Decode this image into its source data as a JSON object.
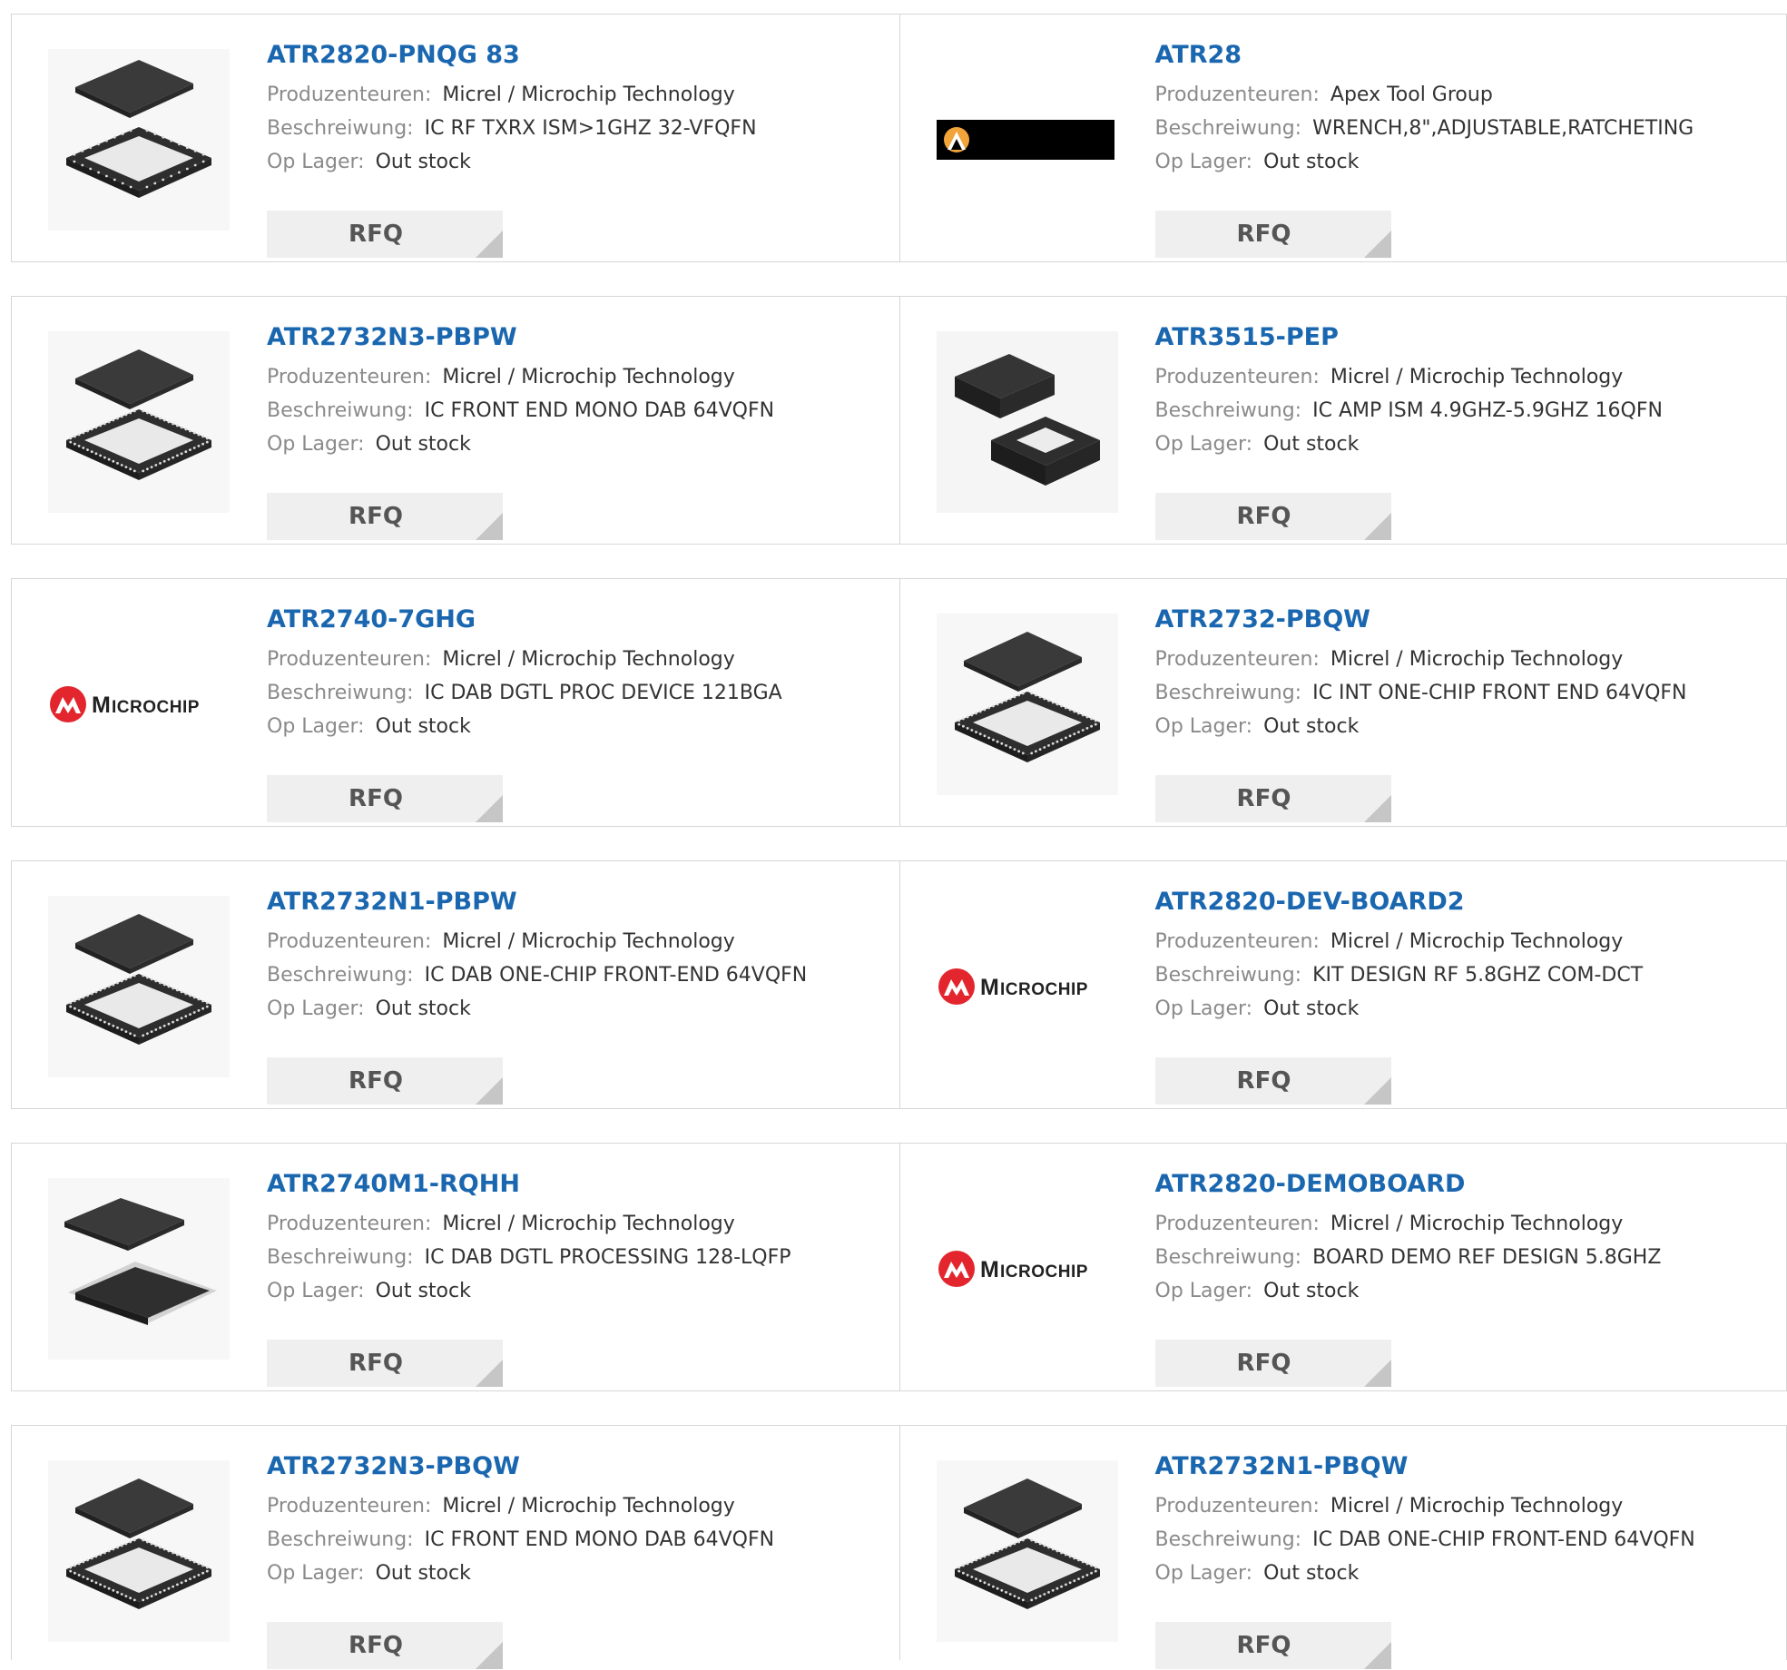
{
  "labels": {
    "manufacturer": "Produzenteuren:",
    "description": "Beschreiwung:",
    "stock": "Op Lager:",
    "rfq": "RFQ"
  },
  "colors": {
    "part_link": "#1a67b0",
    "rfq_bg": "#efefef",
    "microchip_red": "#e3262d"
  },
  "products": [
    {
      "part": "ATR2820-PNQG 83",
      "manufacturer": "Micrel / Microchip Technology",
      "description": "IC RF TXRX ISM>1GHZ 32-VFQFN",
      "stock": "Out stock",
      "image": "qfn-32-chip-icon"
    },
    {
      "part": "ATR28",
      "manufacturer": "Apex Tool Group",
      "description": "WRENCH,8\",ADJUSTABLE,RATCHETING",
      "stock": "Out stock",
      "image": "apex-logo-icon"
    },
    {
      "part": "ATR2732N3-PBPW",
      "manufacturer": "Micrel / Microchip Technology",
      "description": "IC FRONT END MONO DAB 64VQFN",
      "stock": "Out stock",
      "image": "qfn-64-chip-icon"
    },
    {
      "part": "ATR3515-PEP",
      "manufacturer": "Micrel / Microchip Technology",
      "description": "IC AMP ISM 4.9GHZ-5.9GHZ 16QFN",
      "stock": "Out stock",
      "image": "qfn-16-chip-icon"
    },
    {
      "part": "ATR2740-7GHG",
      "manufacturer": "Micrel / Microchip Technology",
      "description": "IC DAB DGTL PROC DEVICE 121BGA",
      "stock": "Out stock",
      "image": "microchip-logo-icon"
    },
    {
      "part": "ATR2732-PBQW",
      "manufacturer": "Micrel / Microchip Technology",
      "description": "IC INT ONE-CHIP FRONT END 64VQFN",
      "stock": "Out stock",
      "image": "qfn-64-chip-icon"
    },
    {
      "part": "ATR2732N1-PBPW",
      "manufacturer": "Micrel / Microchip Technology",
      "description": "IC DAB ONE-CHIP FRONT-END 64VQFN",
      "stock": "Out stock",
      "image": "qfn-64-chip-icon"
    },
    {
      "part": "ATR2820-DEV-BOARD2",
      "manufacturer": "Micrel / Microchip Technology",
      "description": "KIT DESIGN RF 5.8GHZ COM-DCT",
      "stock": "Out stock",
      "image": "microchip-logo-icon"
    },
    {
      "part": "ATR2740M1-RQHH",
      "manufacturer": "Micrel / Microchip Technology",
      "description": "IC DAB DGTL PROCESSING 128-LQFP",
      "stock": "Out stock",
      "image": "lqfp-128-chip-icon"
    },
    {
      "part": "ATR2820-DEMOBOARD",
      "manufacturer": "Micrel / Microchip Technology",
      "description": "BOARD DEMO REF DESIGN 5.8GHZ",
      "stock": "Out stock",
      "image": "microchip-logo-icon"
    },
    {
      "part": "ATR2732N3-PBQW",
      "manufacturer": "Micrel / Microchip Technology",
      "description": "IC FRONT END MONO DAB 64VQFN",
      "stock": "Out stock",
      "image": "qfn-64-chip-icon"
    },
    {
      "part": "ATR2732N1-PBQW",
      "manufacturer": "Micrel / Microchip Technology",
      "description": "IC DAB ONE-CHIP FRONT-END 64VQFN",
      "stock": "Out stock",
      "image": "qfn-64-chip-icon"
    }
  ]
}
